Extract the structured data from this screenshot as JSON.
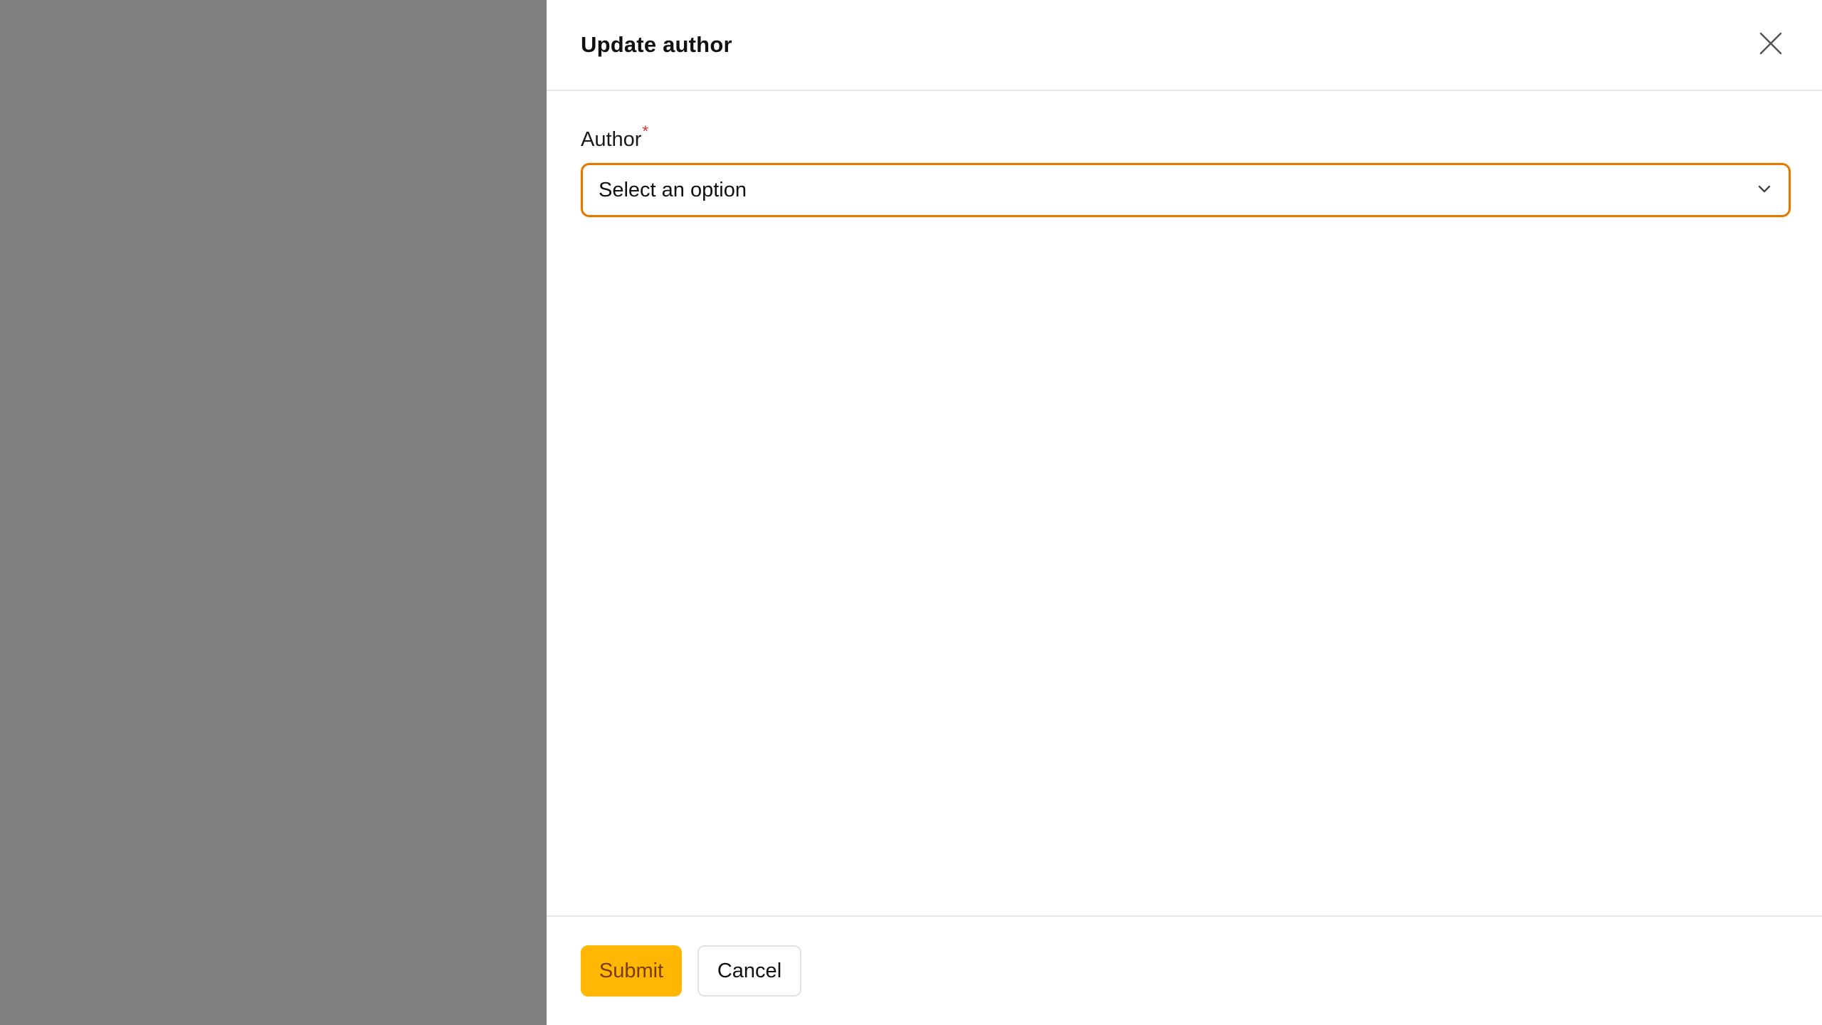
{
  "drawer": {
    "title": "Update author"
  },
  "form": {
    "author_label": "Author",
    "required_mark": "*",
    "author_select_value": "Select an option"
  },
  "footer": {
    "submit_label": "Submit",
    "cancel_label": "Cancel"
  },
  "colors": {
    "backdrop": "#808080",
    "accent_border": "#e07a00",
    "submit_bg": "#ffb703",
    "required": "#d92c2c"
  },
  "icons": {
    "close": "close-icon",
    "dropdown": "chevron-down-icon"
  }
}
